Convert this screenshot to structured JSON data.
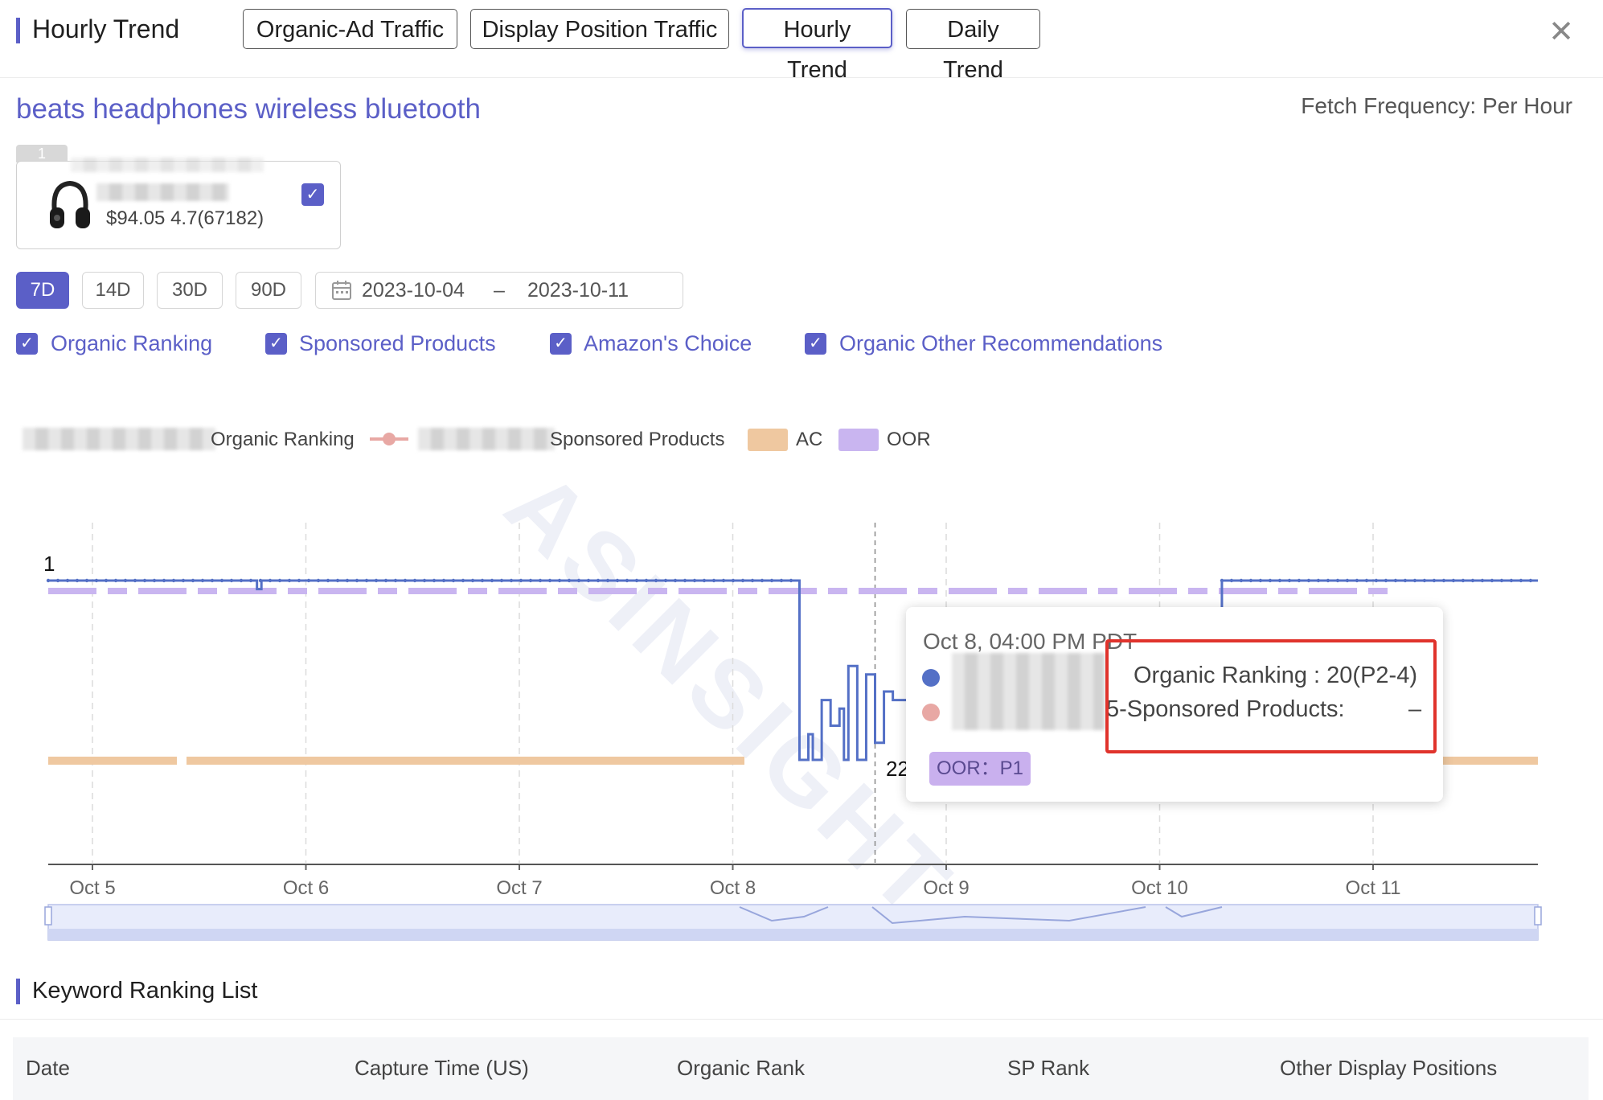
{
  "header": {
    "title": "Hourly Trend",
    "tabs": [
      {
        "label": "Organic-Ad Traffic"
      },
      {
        "label": "Display Position Traffic"
      },
      {
        "label": "Hourly Trend"
      },
      {
        "label": "Daily Trend"
      }
    ],
    "close_icon": "close-icon"
  },
  "keyword": "beats headphones wireless bluetooth",
  "fetch_frequency": "Fetch Frequency: Per Hour",
  "product": {
    "index": "1",
    "price_rating": "$94.05 4.7(67182)",
    "image_icon": "headphones-icon"
  },
  "range": {
    "buttons": [
      "7D",
      "14D",
      "30D",
      "90D"
    ],
    "start": "2023-10-04",
    "separator": "–",
    "end": "2023-10-11",
    "calendar_icon": "calendar-icon"
  },
  "filters": [
    "Organic Ranking",
    "Sponsored Products",
    "Amazon's Choice",
    "Organic Other Recommendations"
  ],
  "legend": {
    "organic": "Organic Ranking",
    "sponsored": "Sponsored Products",
    "ac": "AC",
    "oor": "OOR"
  },
  "colors": {
    "accent": "#5b5fc7",
    "organic": "#5470c6",
    "sponsored": "#e8a8a4",
    "ac": "#efc8a0",
    "oor": "#c9b5f0",
    "highlight": "#e0332c"
  },
  "chart_data": {
    "type": "line",
    "x_ticks": [
      "Oct 5",
      "Oct 6",
      "Oct 7",
      "Oct 8",
      "Oct 9",
      "Oct 10",
      "Oct 11"
    ],
    "y_axis_label": "1",
    "point_label": "22",
    "series": [
      {
        "name": "Organic Ranking",
        "points": [
          [
            "Oct 4 20:00",
            1
          ],
          [
            "Oct 5 18:00",
            1
          ],
          [
            "Oct 5 18:30",
            2
          ],
          [
            "Oct 5 19:00",
            1
          ],
          [
            "Oct 8 07:00",
            1
          ],
          [
            "Oct 8 07:30",
            22
          ],
          [
            "Oct 8 08:30",
            19
          ],
          [
            "Oct 8 09:00",
            22
          ],
          [
            "Oct 8 10:00",
            15
          ],
          [
            "Oct 8 11:00",
            18
          ],
          [
            "Oct 8 12:00",
            16
          ],
          [
            "Oct 8 12:30",
            22
          ],
          [
            "Oct 8 13:00",
            11
          ],
          [
            "Oct 8 14:00",
            22
          ],
          [
            "Oct 8 15:00",
            12
          ],
          [
            "Oct 8 16:00",
            20
          ],
          [
            "Oct 8 17:00",
            14
          ],
          [
            "Oct 8 18:00",
            15
          ],
          [
            "Oct 8 20:00",
            24
          ],
          [
            "Oct 8 21:00",
            16
          ]
        ]
      },
      {
        "name": "AC",
        "level": "constant band"
      },
      {
        "name": "OOR",
        "level": "P1"
      }
    ],
    "tooltip": {
      "time": "Oct 8, 04:00 PM PDT",
      "organic_label": "Organic Ranking : 20(P2-4)",
      "sponsored_label": "5-Sponsored Products:",
      "sponsored_value": "–",
      "oor_badge": "OOR：P1"
    }
  },
  "ranking_list": {
    "title": "Keyword Ranking List",
    "columns": [
      "Date",
      "Capture Time (US)",
      "Organic Rank",
      "SP Rank",
      "Other Display Positions"
    ]
  }
}
